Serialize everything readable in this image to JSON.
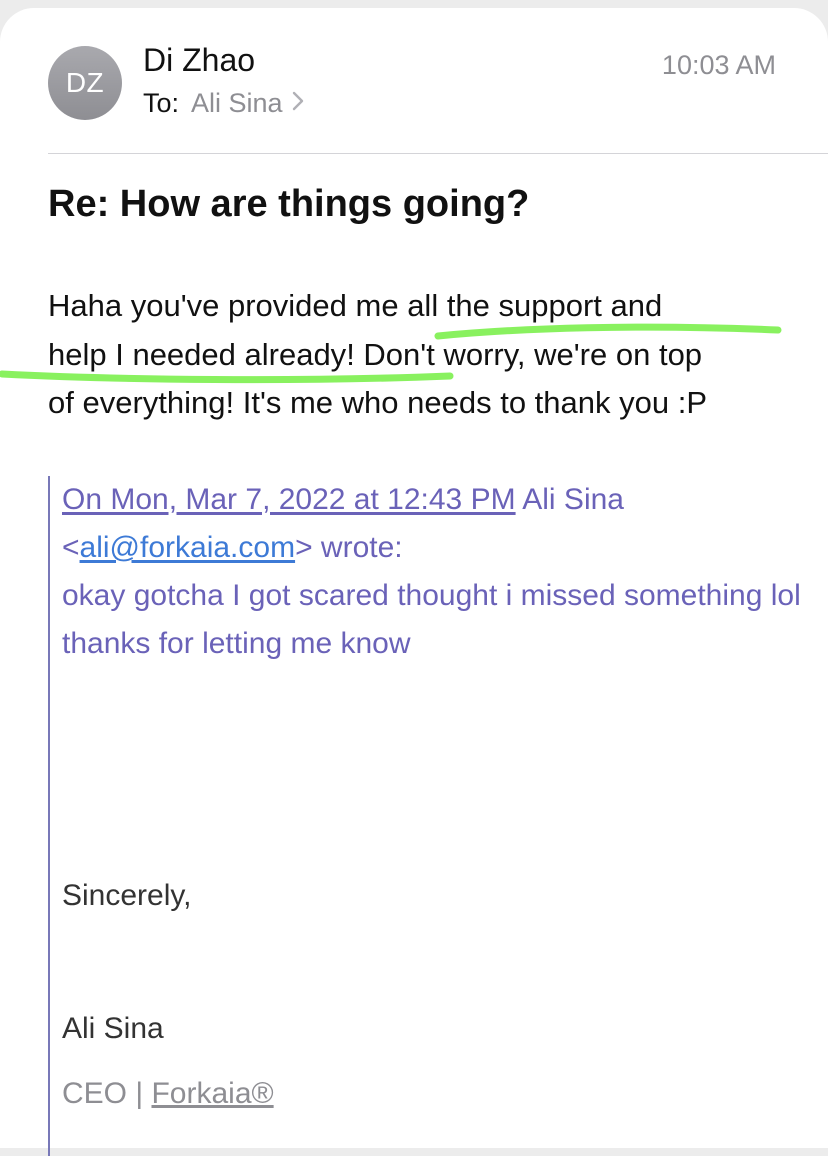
{
  "header": {
    "avatar_initials": "DZ",
    "sender_name": "Di Zhao",
    "to_label": "To:",
    "recipient": "Ali Sina",
    "time": "10:03 AM"
  },
  "subject": "Re: How are things going?",
  "body": {
    "line1_a": "Haha you've provided me ",
    "line1_b": "all the support and",
    "line2_a": "help I needed already",
    "line2_b": "! Don",
    "line2_c": "'t worry, we're on top",
    "line3": "of everything! It's me who needs to thank you :P"
  },
  "quote": {
    "date_link": "On Mon, Mar 7, 2022 at 12:43 PM",
    "author": " Ali Sina",
    "email_open": "<",
    "email": "ali@forkaia.com",
    "email_close": ">",
    "wrote": " wrote:",
    "message": "okay gotcha I got scared thought i missed something lol thanks for letting me know",
    "signoff": "Sincerely,",
    "sig_name": "Ali Sina",
    "sig_title": "CEO | ",
    "sig_company": "Forkaia®"
  },
  "colors": {
    "highlight": "#7cf04e",
    "quote_text": "#6a62b8",
    "link_blue": "#3d7ad6",
    "secondary_gray": "#8e8e93"
  }
}
